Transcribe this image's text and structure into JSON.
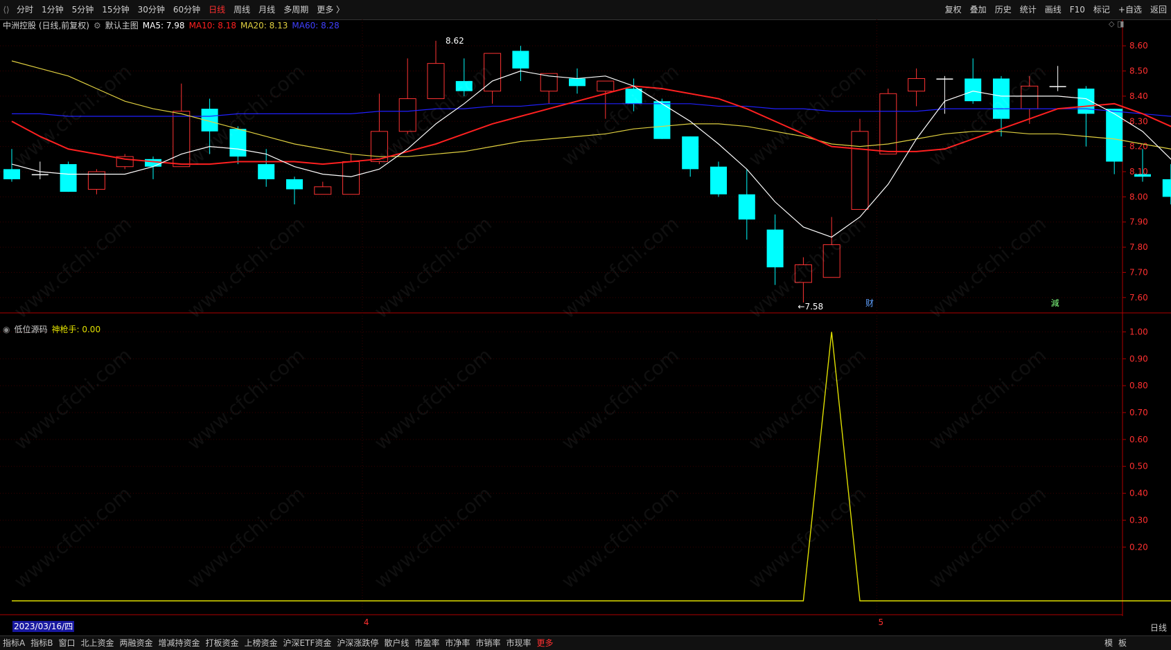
{
  "toolbar": {
    "periods": [
      "分时",
      "1分钟",
      "5分钟",
      "15分钟",
      "30分钟",
      "60分钟",
      "日线",
      "周线",
      "月线",
      "多周期",
      "更多 〉"
    ],
    "active_period": "日线",
    "right": [
      "复权",
      "叠加",
      "历史",
      "统计",
      "画线",
      "F10",
      "标记",
      "+自选",
      "返回"
    ]
  },
  "main_header": {
    "stock": "中洲控股 (日线,前复权)",
    "chart_name": "默认主图",
    "ma5": "MA5: 7.98",
    "ma10": "MA10: 8.18",
    "ma20": "MA20: 8.13",
    "ma60": "MA60: 8.28"
  },
  "indicator_header": {
    "name": "低位源码",
    "value": "神枪手: 0.00"
  },
  "annotations": {
    "high": "8.62",
    "low": "←7.58",
    "cai": "财",
    "jian": "減"
  },
  "date_cursor": "2023/03/16/四",
  "month_labels": [
    "4",
    "5"
  ],
  "colors": {
    "up": "#ff3333",
    "down": "#00ffff",
    "ma5": "#ffffff",
    "ma10": "#ff2020",
    "ma20": "#e0d040",
    "ma60": "#2020ff",
    "indicator": "#e0e000"
  },
  "bottom_tabs": [
    "指标A",
    "指标B",
    "窗口",
    "北上资金",
    "两融资金",
    "增减持资金",
    "打板资金",
    "上榜资金",
    "沪深ETF资金",
    "沪深涨跌停",
    "散户线",
    "市盈率",
    "市净率",
    "市销率",
    "市现率",
    "更多"
  ],
  "bottom_right": [
    "模",
    "板"
  ],
  "period_box": "日线",
  "watermark": "www.cfchi.com",
  "chart_data": [
    {
      "type": "candlestick",
      "ylim": [
        7.55,
        8.65
      ],
      "y_ticks": [
        "8.60",
        "8.50",
        "8.40",
        "8.30",
        "8.20",
        "8.10",
        "8.00",
        "7.90",
        "7.80",
        "7.70",
        "7.60"
      ],
      "candles": [
        {
          "o": 8.11,
          "c": 8.07,
          "h": 8.19,
          "l": 8.06
        },
        {
          "o": 8.09,
          "c": 8.09,
          "h": 8.14,
          "l": 8.07
        },
        {
          "o": 8.13,
          "c": 8.02,
          "h": 8.14,
          "l": 8.02
        },
        {
          "o": 8.03,
          "c": 8.1,
          "h": 8.11,
          "l": 8.01
        },
        {
          "o": 8.12,
          "c": 8.16,
          "h": 8.17,
          "l": 8.11
        },
        {
          "o": 8.15,
          "c": 8.12,
          "h": 8.16,
          "l": 8.07
        },
        {
          "o": 8.12,
          "c": 8.34,
          "h": 8.45,
          "l": 8.12
        },
        {
          "o": 8.35,
          "c": 8.26,
          "h": 8.39,
          "l": 8.17
        },
        {
          "o": 8.27,
          "c": 8.16,
          "h": 8.28,
          "l": 8.13
        },
        {
          "o": 8.13,
          "c": 8.07,
          "h": 8.19,
          "l": 8.04
        },
        {
          "o": 8.07,
          "c": 8.03,
          "h": 8.08,
          "l": 7.97
        },
        {
          "o": 8.01,
          "c": 8.04,
          "h": 8.06,
          "l": 8.01
        },
        {
          "o": 8.01,
          "c": 8.14,
          "h": 8.17,
          "l": 8.01
        },
        {
          "o": 8.14,
          "c": 8.26,
          "h": 8.41,
          "l": 8.13
        },
        {
          "o": 8.26,
          "c": 8.39,
          "h": 8.55,
          "l": 8.25
        },
        {
          "o": 8.39,
          "c": 8.53,
          "h": 8.62,
          "l": 8.39
        },
        {
          "o": 8.46,
          "c": 8.42,
          "h": 8.55,
          "l": 8.4
        },
        {
          "o": 8.42,
          "c": 8.57,
          "h": 8.57,
          "l": 8.37
        },
        {
          "o": 8.58,
          "c": 8.51,
          "h": 8.6,
          "l": 8.46
        },
        {
          "o": 8.42,
          "c": 8.49,
          "h": 8.49,
          "l": 8.37
        },
        {
          "o": 8.47,
          "c": 8.44,
          "h": 8.51,
          "l": 8.41
        },
        {
          "o": 8.42,
          "c": 8.46,
          "h": 8.46,
          "l": 8.31
        },
        {
          "o": 8.43,
          "c": 8.37,
          "h": 8.47,
          "l": 8.34
        },
        {
          "o": 8.38,
          "c": 8.23,
          "h": 8.39,
          "l": 8.23
        },
        {
          "o": 8.24,
          "c": 8.11,
          "h": 8.24,
          "l": 8.08
        },
        {
          "o": 8.12,
          "c": 8.01,
          "h": 8.14,
          "l": 8.0
        },
        {
          "o": 8.01,
          "c": 7.91,
          "h": 8.11,
          "l": 7.83
        },
        {
          "o": 7.87,
          "c": 7.72,
          "h": 7.93,
          "l": 7.65
        },
        {
          "o": 7.66,
          "c": 7.73,
          "h": 7.76,
          "l": 7.58
        },
        {
          "o": 7.68,
          "c": 7.81,
          "h": 7.92,
          "l": 7.68
        },
        {
          "o": 7.95,
          "c": 8.26,
          "h": 8.31,
          "l": 7.95
        },
        {
          "o": 8.17,
          "c": 8.41,
          "h": 8.43,
          "l": 8.17
        },
        {
          "o": 8.42,
          "c": 8.47,
          "h": 8.51,
          "l": 8.36
        },
        {
          "o": 8.47,
          "c": 8.47,
          "h": 8.48,
          "l": 8.33
        },
        {
          "o": 8.47,
          "c": 8.38,
          "h": 8.55,
          "l": 8.37
        },
        {
          "o": 8.47,
          "c": 8.31,
          "h": 8.48,
          "l": 8.24
        },
        {
          "o": 8.35,
          "c": 8.44,
          "h": 8.48,
          "l": 8.29
        },
        {
          "o": 8.44,
          "c": 8.44,
          "h": 8.52,
          "l": 8.42
        },
        {
          "o": 8.43,
          "c": 8.33,
          "h": 8.44,
          "l": 8.2
        },
        {
          "o": 8.35,
          "c": 8.14,
          "h": 8.35,
          "l": 8.09
        },
        {
          "o": 8.09,
          "c": 8.08,
          "h": 8.19,
          "l": 8.06
        },
        {
          "o": 8.07,
          "c": 8.0,
          "h": 8.13,
          "l": 7.97
        },
        {
          "o": 7.98,
          "c": 7.89,
          "h": 8.0,
          "l": 7.82
        },
        {
          "o": 7.89,
          "c": 7.81,
          "h": 7.91,
          "l": 7.77
        }
      ],
      "ma5": [
        8.13,
        8.1,
        8.09,
        8.09,
        8.09,
        8.12,
        8.17,
        8.2,
        8.19,
        8.17,
        8.12,
        8.09,
        8.08,
        8.11,
        8.19,
        8.29,
        8.37,
        8.46,
        8.5,
        8.48,
        8.47,
        8.48,
        8.44,
        8.37,
        8.3,
        8.21,
        8.11,
        7.98,
        7.88,
        7.84,
        7.92,
        8.05,
        8.23,
        8.38,
        8.42,
        8.4,
        8.4,
        8.4,
        8.39,
        8.33,
        8.26,
        8.15,
        8.06,
        7.98
      ],
      "ma10": [
        8.3,
        8.24,
        8.19,
        8.17,
        8.15,
        8.14,
        8.13,
        8.13,
        8.14,
        8.14,
        8.14,
        8.13,
        8.14,
        8.15,
        8.18,
        8.21,
        8.25,
        8.29,
        8.32,
        8.35,
        8.38,
        8.41,
        8.44,
        8.43,
        8.41,
        8.39,
        8.35,
        8.3,
        8.25,
        8.2,
        8.19,
        8.18,
        8.18,
        8.19,
        8.23,
        8.27,
        8.31,
        8.35,
        8.36,
        8.37,
        8.33,
        8.28,
        8.23,
        8.18
      ],
      "ma20": [
        8.54,
        8.51,
        8.48,
        8.43,
        8.38,
        8.35,
        8.33,
        8.3,
        8.27,
        8.24,
        8.21,
        8.19,
        8.17,
        8.16,
        8.16,
        8.17,
        8.18,
        8.2,
        8.22,
        8.23,
        8.24,
        8.25,
        8.27,
        8.28,
        8.29,
        8.29,
        8.28,
        8.26,
        8.24,
        8.21,
        8.2,
        8.21,
        8.23,
        8.25,
        8.26,
        8.26,
        8.25,
        8.25,
        8.24,
        8.23,
        8.21,
        8.19,
        8.16,
        8.13
      ],
      "ma60": [
        8.33,
        8.33,
        8.32,
        8.32,
        8.32,
        8.32,
        8.32,
        8.32,
        8.33,
        8.33,
        8.33,
        8.33,
        8.33,
        8.34,
        8.34,
        8.35,
        8.35,
        8.36,
        8.36,
        8.37,
        8.37,
        8.37,
        8.37,
        8.37,
        8.37,
        8.36,
        8.36,
        8.35,
        8.35,
        8.34,
        8.34,
        8.34,
        8.34,
        8.35,
        8.35,
        8.35,
        8.35,
        8.35,
        8.35,
        8.34,
        8.33,
        8.32,
        8.3,
        8.28
      ]
    },
    {
      "type": "line",
      "series_name": "神枪手",
      "ylim": [
        0,
        1.05
      ],
      "y_ticks": [
        "1.00",
        "0.90",
        "0.80",
        "0.70",
        "0.60",
        "0.50",
        "0.40",
        "0.30",
        "0.20"
      ],
      "values": [
        0,
        0,
        0,
        0,
        0,
        0,
        0,
        0,
        0,
        0,
        0,
        0,
        0,
        0,
        0,
        0,
        0,
        0,
        0,
        0,
        0,
        0,
        0,
        0,
        0,
        0,
        0,
        0,
        0,
        1,
        0,
        0,
        0,
        0,
        0,
        0,
        0,
        0,
        0,
        0,
        0,
        0,
        0,
        0
      ]
    }
  ]
}
